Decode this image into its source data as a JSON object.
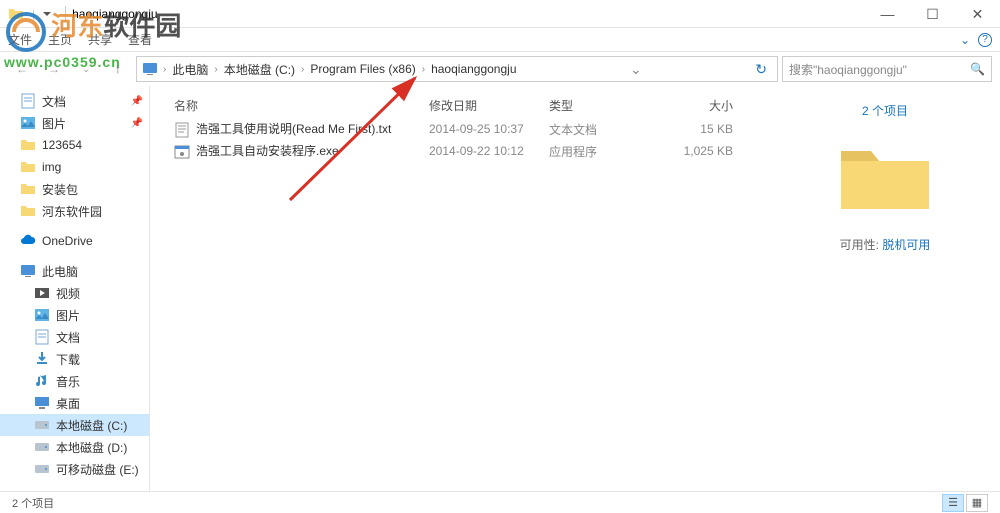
{
  "titlebar": {
    "title": "haoqianggongju"
  },
  "ribbon": {
    "tabs": [
      "主页",
      "共享",
      "查看"
    ]
  },
  "breadcrumb": {
    "items": [
      "此电脑",
      "本地磁盘 (C:)",
      "Program Files (x86)",
      "haoqianggongju"
    ],
    "search_placeholder": "搜索\"haoqianggongju\""
  },
  "sidebar": {
    "quick": [
      {
        "label": "文档",
        "icon": "doc",
        "pinned": true
      },
      {
        "label": "图片",
        "icon": "pic",
        "pinned": true
      },
      {
        "label": "123654",
        "icon": "folder"
      },
      {
        "label": "img",
        "icon": "folder"
      },
      {
        "label": "安装包",
        "icon": "folder"
      },
      {
        "label": "河东软件园",
        "icon": "folder"
      }
    ],
    "onedrive": {
      "label": "OneDrive"
    },
    "thispc": {
      "label": "此电脑",
      "children": [
        {
          "label": "视频",
          "icon": "video"
        },
        {
          "label": "图片",
          "icon": "pic"
        },
        {
          "label": "文档",
          "icon": "doc"
        },
        {
          "label": "下载",
          "icon": "download"
        },
        {
          "label": "音乐",
          "icon": "music"
        },
        {
          "label": "桌面",
          "icon": "desktop"
        },
        {
          "label": "本地磁盘 (C:)",
          "icon": "disk",
          "selected": true
        },
        {
          "label": "本地磁盘 (D:)",
          "icon": "disk"
        },
        {
          "label": "可移动磁盘 (E:)",
          "icon": "disk"
        }
      ]
    }
  },
  "columns": {
    "name": "名称",
    "date": "修改日期",
    "type": "类型",
    "size": "大小"
  },
  "files": [
    {
      "name": "浩强工具使用说明(Read Me First).txt",
      "date": "2014-09-25 10:37",
      "type": "文本文档",
      "size": "15 KB",
      "icon": "txt"
    },
    {
      "name": "浩强工具自动安装程序.exe",
      "date": "2014-09-22 10:12",
      "type": "应用程序",
      "size": "1,025 KB",
      "icon": "exe"
    }
  ],
  "preview": {
    "count": "2 个项目",
    "avail_label": "可用性:",
    "avail_value": "脱机可用"
  },
  "statusbar": {
    "text": "2 个项目"
  },
  "watermark": {
    "brand": "河东软件园",
    "url": "www.pc0359.cn"
  }
}
